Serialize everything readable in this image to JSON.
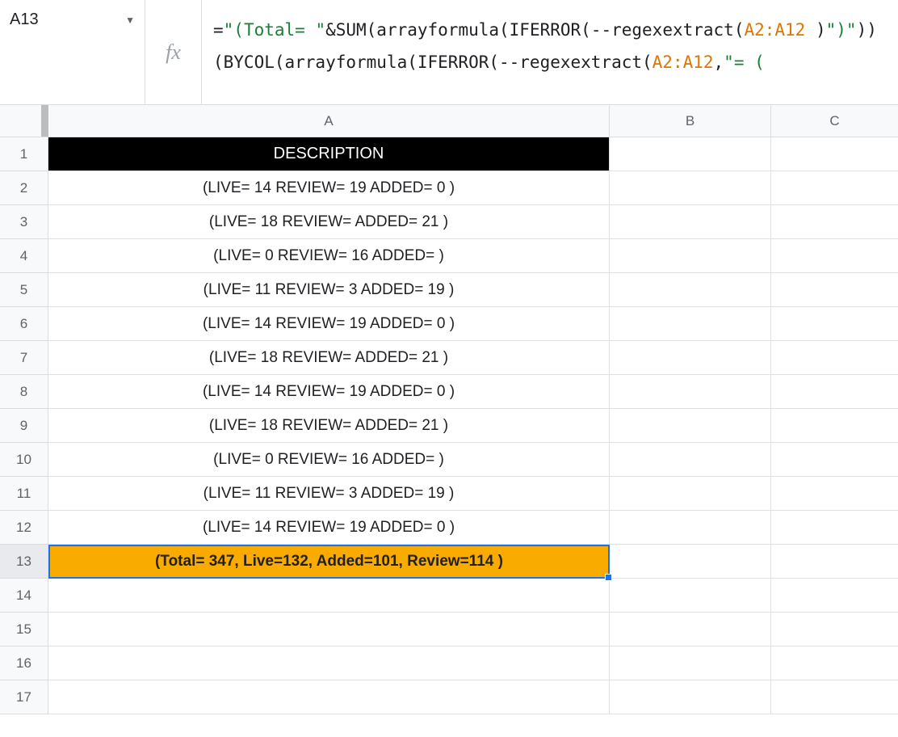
{
  "nameBox": {
    "value": "A13"
  },
  "fxLabel": "fx",
  "formula": {
    "parts": [
      {
        "t": "=",
        "c": "text"
      },
      {
        "t": "\"(Total= \"",
        "c": "green"
      },
      {
        "t": "&SUM(arrayformula(IFERROR(--regexextract(",
        "c": "text"
      },
      {
        "t": "A2:A12",
        "c": "orange"
      },
      {
        "t": " )",
        "c": "text"
      },
      {
        "t": "\")\"",
        "c": "green"
      },
      {
        "t": "))(BYCOL(arrayformula(IFERROR(--regexextract(",
        "c": "text"
      },
      {
        "t": "A2:A12",
        "c": "orange"
      },
      {
        "t": ",",
        "c": "text"
      },
      {
        "t": "\"= (",
        "c": "green"
      }
    ]
  },
  "columns": [
    "A",
    "B",
    "C"
  ],
  "rows": [
    {
      "num": "1",
      "a": "DESCRIPTION",
      "header": true
    },
    {
      "num": "2",
      "a": "(LIVE= 14 REVIEW= 19 ADDED= 0 )"
    },
    {
      "num": "3",
      "a": "(LIVE= 18 REVIEW=  ADDED= 21 )"
    },
    {
      "num": "4",
      "a": "(LIVE= 0 REVIEW= 16 ADDED=  )"
    },
    {
      "num": "5",
      "a": "(LIVE= 11 REVIEW= 3 ADDED= 19 )"
    },
    {
      "num": "6",
      "a": "(LIVE= 14 REVIEW= 19 ADDED= 0 )"
    },
    {
      "num": "7",
      "a": "(LIVE= 18 REVIEW=  ADDED= 21 )"
    },
    {
      "num": "8",
      "a": "(LIVE= 14 REVIEW= 19 ADDED= 0 )"
    },
    {
      "num": "9",
      "a": "(LIVE= 18 REVIEW=  ADDED= 21 )"
    },
    {
      "num": "10",
      "a": "(LIVE= 0 REVIEW= 16 ADDED=  )"
    },
    {
      "num": "11",
      "a": "(LIVE= 11 REVIEW= 3 ADDED= 19 )"
    },
    {
      "num": "12",
      "a": "(LIVE= 14 REVIEW= 19 ADDED= 0 )"
    },
    {
      "num": "13",
      "a": "(Total= 347, Live=132, Added=101, Review=114 )",
      "selected": true
    },
    {
      "num": "14",
      "a": ""
    },
    {
      "num": "15",
      "a": ""
    },
    {
      "num": "16",
      "a": ""
    },
    {
      "num": "17",
      "a": ""
    }
  ]
}
